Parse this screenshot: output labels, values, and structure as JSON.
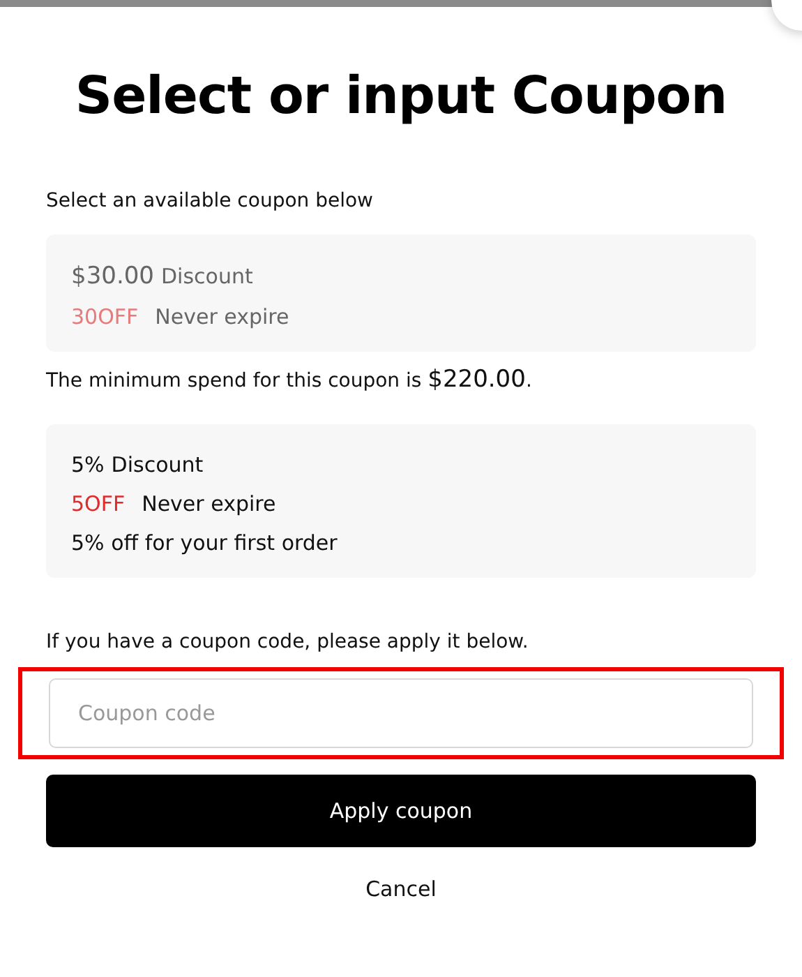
{
  "dialog": {
    "title": "Select or input Coupon",
    "close_visible": true
  },
  "available_label": "Select an available coupon below",
  "coupons": [
    {
      "amount": "$30.00",
      "label": "Discount",
      "code": "30OFF",
      "expiry": "Never expire",
      "disabled": true,
      "notice": "The minimum spend for this coupon is ",
      "notice_amount": "$220.00",
      "notice_end": "."
    },
    {
      "amount": "5%",
      "label": "Discount",
      "code": "5OFF",
      "expiry": "Never expire",
      "disabled": false,
      "description": "5% off for your first order"
    }
  ],
  "code_label": "If you have a coupon code, please apply it below.",
  "code_field": {
    "placeholder": "Coupon code",
    "highlighted": true
  },
  "apply_button": "Apply coupon",
  "cancel_button": "Cancel"
}
